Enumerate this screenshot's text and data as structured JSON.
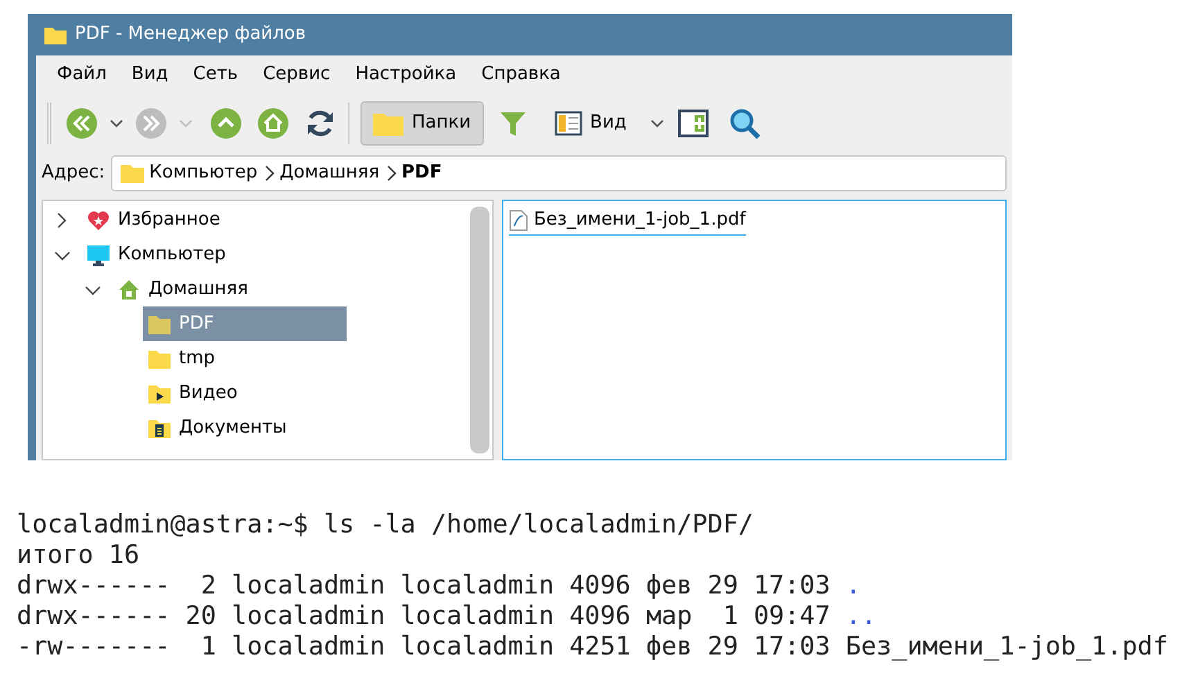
{
  "window": {
    "title": "PDF - Менеджер файлов"
  },
  "menu": [
    "Файл",
    "Вид",
    "Сеть",
    "Сервис",
    "Настройка",
    "Справка"
  ],
  "toolbar": [
    {
      "kind": "back",
      "disabled": false
    },
    {
      "kind": "caret",
      "disabled": false
    },
    {
      "kind": "forward",
      "disabled": true
    },
    {
      "kind": "caret",
      "disabled": true
    },
    {
      "kind": "up",
      "disabled": false
    },
    {
      "kind": "home",
      "disabled": false
    },
    {
      "kind": "refresh",
      "disabled": false
    },
    {
      "kind": "separator"
    },
    {
      "kind": "folders",
      "label": "Папки",
      "selected": true
    },
    {
      "kind": "filter"
    },
    {
      "kind": "view",
      "label": "Вид",
      "selected": false
    },
    {
      "kind": "caret",
      "disabled": false
    },
    {
      "kind": "panel"
    },
    {
      "kind": "search"
    }
  ],
  "address": {
    "label": "Адрес:",
    "crumbs": [
      {
        "text": "Компьютер",
        "current": false
      },
      {
        "text": "Домашняя",
        "current": false
      },
      {
        "text": "PDF",
        "current": true
      }
    ]
  },
  "tree": [
    {
      "label": "Избранное",
      "kind": "favorites",
      "expanded": false,
      "selected": false
    },
    {
      "label": "Компьютер",
      "kind": "computer",
      "expanded": true,
      "selected": false,
      "children": [
        {
          "label": "Домашняя",
          "kind": "home",
          "expanded": true,
          "selected": false,
          "children": [
            {
              "label": "PDF",
              "kind": "folder",
              "selected": true
            },
            {
              "label": "tmp",
              "kind": "folder",
              "selected": false
            },
            {
              "label": "Видео",
              "kind": "video",
              "selected": false
            },
            {
              "label": "Документы",
              "kind": "documents",
              "selected": false
            }
          ]
        }
      ]
    }
  ],
  "files": [
    {
      "name": "Без_имени_1-job_1.pdf",
      "selected": true
    }
  ],
  "terminal": {
    "prompt": "localadmin@astra:~$ ls -la /home/localadmin/PDF/",
    "total": "итого 16",
    "entries": [
      {
        "info": "drwx------  2 localadmin localadmin 4096 фев 29 17:03",
        "name": ".",
        "kind": "dir"
      },
      {
        "info": "drwx------ 20 localadmin localadmin 4096 мар  1 09:47",
        "name": "..",
        "kind": "dir"
      },
      {
        "info": "-rw-------  1 localadmin localadmin 4251 фев 29 17:03",
        "name": "Без_имени_1-job_1.pdf",
        "kind": "file"
      }
    ]
  }
}
